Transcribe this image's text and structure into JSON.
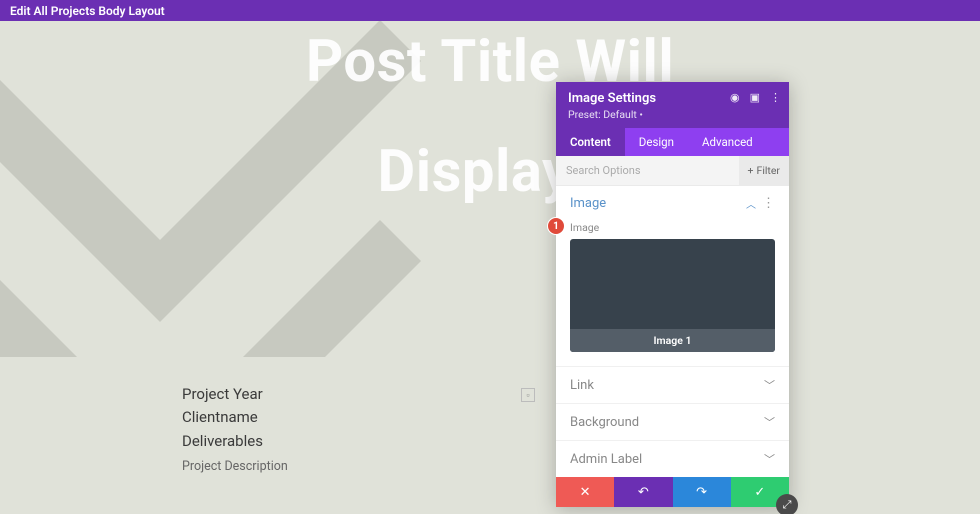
{
  "topbar": {
    "title": "Edit All Projects Body Layout"
  },
  "hero": {
    "line1": "Post Title Will",
    "line2": "Display l"
  },
  "project": {
    "year": "Project Year",
    "client": "Clientname",
    "deliverables": "Deliverables",
    "description": "Project Description"
  },
  "panel": {
    "title": "Image Settings",
    "preset": "Preset: Default •",
    "tabs": {
      "content": "Content",
      "design": "Design",
      "advanced": "Advanced"
    },
    "search_placeholder": "Search Options",
    "filter_label": "Filter",
    "sections": {
      "image": {
        "title": "Image",
        "field_label": "Image",
        "caption": "Image 1"
      },
      "link": {
        "title": "Link"
      },
      "background": {
        "title": "Background"
      },
      "admin_label": {
        "title": "Admin Label"
      }
    }
  },
  "badge": "1"
}
